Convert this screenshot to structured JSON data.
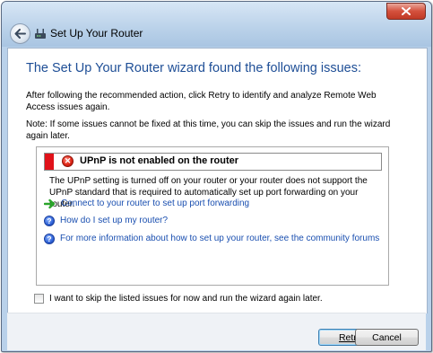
{
  "window": {
    "title": "Set Up Your Router",
    "close_label": "X"
  },
  "main": {
    "heading": "The Set Up Your Router wizard found the following issues:",
    "para1": "After following the recommended action, click Retry to identify and analyze Remote Web Access issues again.",
    "para2": "Note: If some issues cannot be fixed at this time, you can skip the issues and run the wizard again later."
  },
  "issue": {
    "title": "UPnP is not enabled on the router",
    "description": "The UPnP setting is turned off on your router or your router does not support the UPnP standard that is required to automatically set up port forwarding on your router.",
    "links": [
      {
        "label": "Connect to your router to set up port forwarding",
        "icon": "green-arrow-icon"
      },
      {
        "label": "How do I set up my router?",
        "icon": "help-icon"
      },
      {
        "label": "For more information about how to set up your router, see the community forums",
        "icon": "help-icon"
      }
    ]
  },
  "skip": {
    "label": "I want to skip the listed issues for now and run the wizard again later.",
    "checked": false
  },
  "buttons": {
    "retry": "Retry",
    "cancel": "Cancel"
  },
  "colors": {
    "heading": "#1e4e96",
    "link": "#1a4fb0",
    "error_bar": "#e0121a",
    "close_button": "#c03a26"
  }
}
